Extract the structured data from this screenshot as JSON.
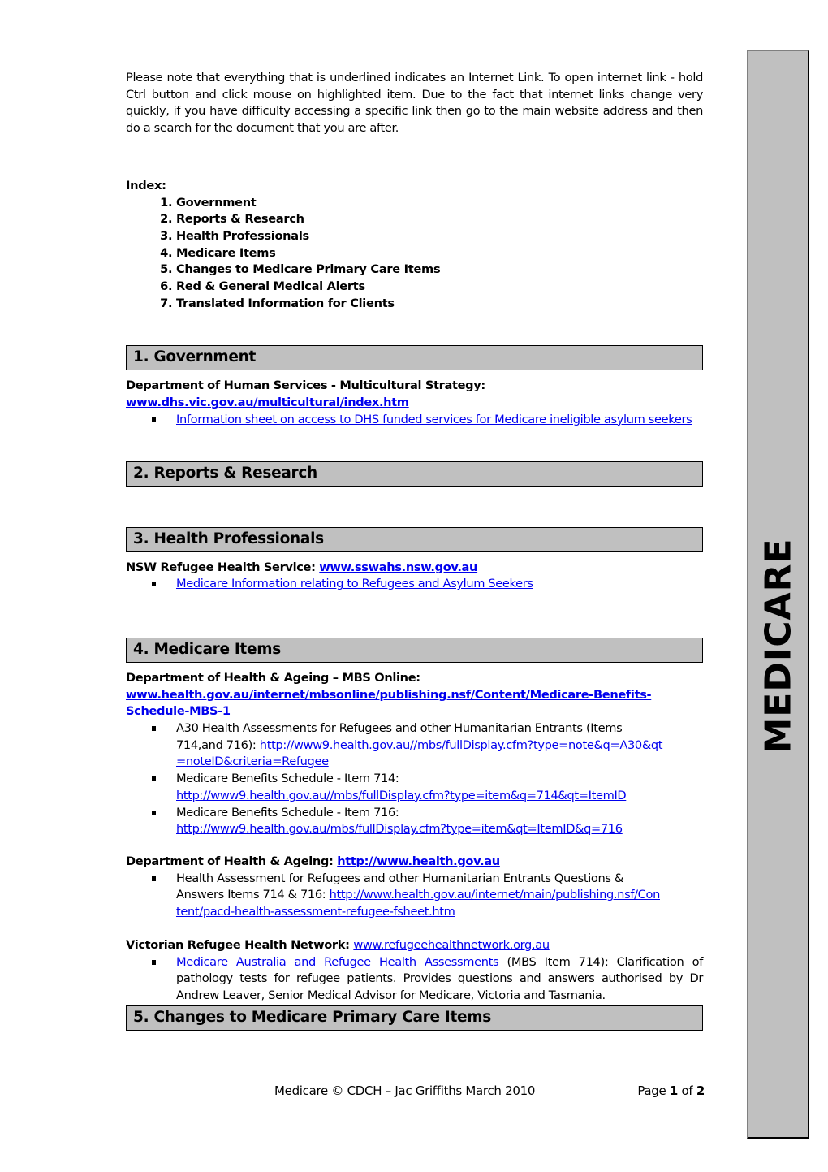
{
  "intro_note": "Please note that everything that is underlined indicates an Internet Link. To open internet link - hold Ctrl button and click mouse on highlighted item.  Due to the fact that internet links change very quickly, if you have difficulty accessing a specific link then go to the main website address and then do a search for the document that you are after.",
  "index": {
    "title": "Index:",
    "items": [
      "Government",
      "Reports & Research",
      "Health Professionals",
      "Medicare Items",
      "Changes to Medicare Primary Care Items",
      "Red & General Medical Alerts",
      "Translated Information for Clients"
    ]
  },
  "sections": {
    "government": {
      "header": "1. Government",
      "source_label": "Department of Human Services - Multicultural Strategy:",
      "source_link": "www.dhs.vic.gov.au/multicultural/index.htm",
      "items": [
        "Information sheet on access to DHS funded services for Medicare ineligible asylum seekers "
      ]
    },
    "reports": {
      "header": "2. Reports & Research"
    },
    "health_professionals": {
      "header": "3. Health Professionals",
      "source_label": "NSW Refugee Health Service: ",
      "source_link": "www.sswahs.nsw.gov.au",
      "items": [
        "Medicare Information relating to Refugees and Asylum Seekers"
      ]
    },
    "medicare_items": {
      "header": "4. Medicare Items",
      "group1": {
        "source_label": "Department of Health & Ageing – MBS Online:",
        "source_link": "www.health.gov.au/internet/mbsonline/publishing.nsf/Content/Medicare-Benefits-Schedule-MBS-1",
        "items": [
          {
            "text": "A30 Health Assessments for Refugees and other Humanitarian Entrants (Items 714,and 716): ",
            "link": "http://www9.health.gov.au//mbs/fullDisplay.cfm?type=note&q=A30&qt=noteID&criteria=Refugee"
          },
          {
            "text": "Medicare Benefits Schedule - Item 714: ",
            "link": "http://www9.health.gov.au//mbs/fullDisplay.cfm?type=item&q=714&qt=ItemID"
          },
          {
            "text": "Medicare Benefits Schedule - Item 716: ",
            "link": "http://www9.health.gov.au/mbs/fullDisplay.cfm?type=item&qt=ItemID&q=716"
          }
        ]
      },
      "group2": {
        "source_label": "Department of Health & Ageing: ",
        "source_link": "http://www.health.gov.au",
        "items": [
          {
            "text": "Health Assessment for Refugees and other Humanitarian Entrants Questions & Answers Items 714 & 716: ",
            "link": "http://www.health.gov.au/internet/main/publishing.nsf/Content/pacd-health-assessment-refugee-fsheet.htm"
          }
        ]
      },
      "group3": {
        "source_label": "Victorian Refugee Health Network: ",
        "source_link": "www.refugeehealthnetwork.org.au",
        "items": [
          {
            "link": "Medicare Australia and Refugee Health Assessments ",
            "text": "(MBS Item 714): Clarification of pathology tests for refugee patients. Provides questions and answers authorised by Dr Andrew Leaver, Senior Medical Advisor for Medicare, Victoria and Tasmania."
          }
        ]
      }
    },
    "changes": {
      "header": "5. Changes to Medicare Primary Care Items"
    }
  },
  "sidebar_label": "MEDICARE",
  "footer": {
    "left": "Medicare © CDCH – Jac Griffiths March 2010",
    "page_word": "Page ",
    "page_current": "1",
    "page_of": " of ",
    "page_total": "2"
  }
}
